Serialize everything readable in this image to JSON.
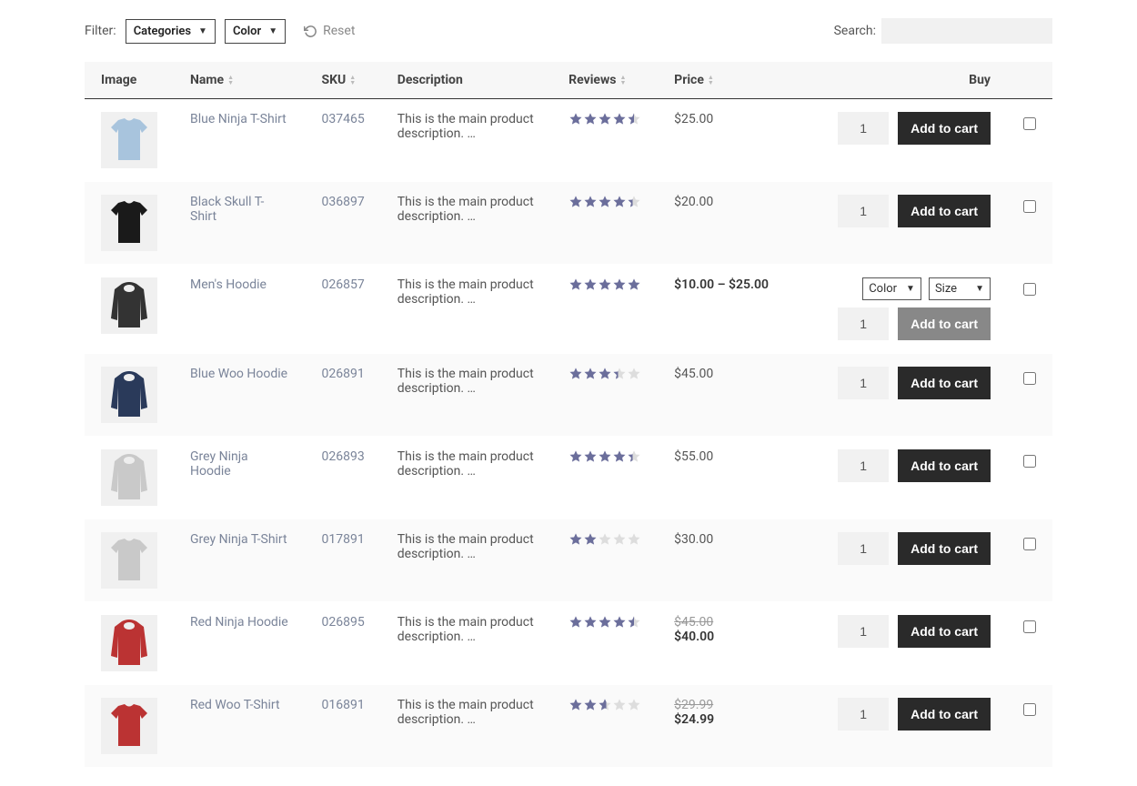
{
  "toolbar": {
    "filterLabel": "Filter:",
    "categories": "Categories",
    "color": "Color",
    "reset": "Reset",
    "searchLabel": "Search:"
  },
  "headers": {
    "image": "Image",
    "name": "Name",
    "sku": "SKU",
    "description": "Description",
    "reviews": "Reviews",
    "price": "Price",
    "buy": "Buy"
  },
  "buttons": {
    "addToCart": "Add to cart",
    "colorOpt": "Color",
    "sizeOpt": "Size"
  },
  "products": [
    {
      "name": "Blue Ninja T-Shirt",
      "sku": "037465",
      "desc": "This is the main product description. …",
      "rating": 4.5,
      "price": "$25.00",
      "qty": "1",
      "shape": "tshirt",
      "fill": "#a8c4dd",
      "hasVariations": false,
      "disabled": false
    },
    {
      "name": "Black Skull T-Shirt",
      "sku": "036897",
      "desc": "This is the main product description. …",
      "rating": 4.4,
      "price": "$20.00",
      "qty": "1",
      "shape": "tshirt",
      "fill": "#1a1a1a",
      "hasVariations": false,
      "disabled": false
    },
    {
      "name": "Men's Hoodie",
      "sku": "026857",
      "desc": "This is the main product description. …",
      "rating": 5.0,
      "priceRange": "$10.00 – $25.00",
      "qty": "1",
      "shape": "hoodie",
      "fill": "#333",
      "hasVariations": true,
      "disabled": true
    },
    {
      "name": "Blue Woo Hoodie",
      "sku": "026891",
      "desc": "This is the main product description. …",
      "rating": 3.4,
      "price": "$45.00",
      "qty": "1",
      "shape": "hoodie",
      "fill": "#2a3a5a",
      "hasVariations": false,
      "disabled": false
    },
    {
      "name": "Grey Ninja Hoodie",
      "sku": "026893",
      "desc": "This is the main product description. …",
      "rating": 4.4,
      "price": "$55.00",
      "qty": "1",
      "shape": "hoodie",
      "fill": "#c9c9c9",
      "hasVariations": false,
      "disabled": false
    },
    {
      "name": "Grey Ninja T-Shirt",
      "sku": "017891",
      "desc": "This is the main product description. …",
      "rating": 2.0,
      "price": "$30.00",
      "qty": "1",
      "shape": "tshirt",
      "fill": "#c9c9c9",
      "hasVariations": false,
      "disabled": false
    },
    {
      "name": "Red Ninja Hoodie",
      "sku": "026895",
      "desc": "This is the main product description. …",
      "rating": 4.5,
      "origPrice": "$45.00",
      "salePrice": "$40.00",
      "qty": "1",
      "shape": "hoodie",
      "fill": "#b33",
      "hasVariations": false,
      "disabled": false
    },
    {
      "name": "Red Woo T-Shirt",
      "sku": "016891",
      "desc": "This is the main product description. …",
      "rating": 2.6,
      "origPrice": "$29.99",
      "salePrice": "$24.99",
      "qty": "1",
      "shape": "tshirt",
      "fill": "#b33",
      "hasVariations": false,
      "disabled": false
    }
  ]
}
